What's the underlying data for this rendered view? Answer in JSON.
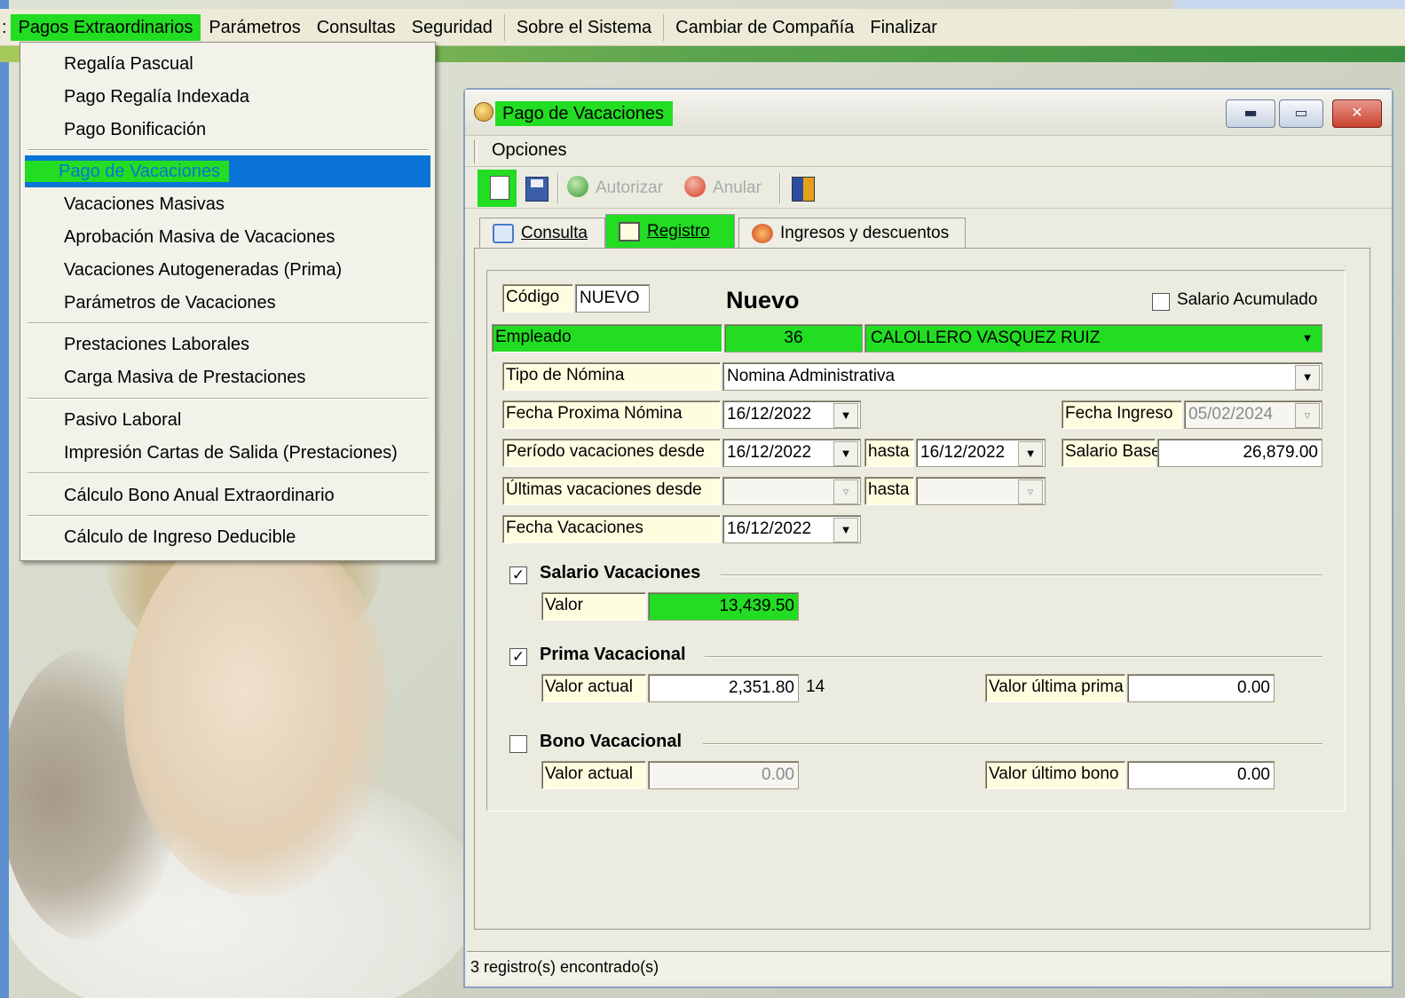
{
  "menubar": {
    "lead": ":",
    "items": [
      "Pagos Extraordinarios",
      "Parámetros",
      "Consultas",
      "Seguridad",
      "Sobre el Sistema",
      "Cambiar de Compañía",
      "Finalizar"
    ]
  },
  "dropdown": {
    "items": [
      "Regalía Pascual",
      "Pago Regalía Indexada",
      "Pago Bonificación",
      "Pago de Vacaciones",
      "Vacaciones Masivas",
      "Aprobación Masiva de Vacaciones",
      "Vacaciones Autogeneradas (Prima)",
      "Parámetros de Vacaciones",
      "Prestaciones Laborales",
      "Carga Masiva de Prestaciones",
      "Pasivo Laboral",
      "Impresión Cartas de Salida (Prestaciones)",
      "Cálculo Bono Anual Extraordinario",
      "Cálculo de Ingreso Deducible"
    ]
  },
  "window": {
    "title": "Pago de Vacaciones",
    "options_label": "Opciones",
    "toolbar": {
      "authorize": "Autorizar",
      "cancel": "Anular"
    },
    "tabs": {
      "consulta": "Consulta",
      "registro": "Registro",
      "ingresos": "Ingresos y descuentos"
    },
    "status": "3 registro(s) encontrado(s)"
  },
  "form": {
    "codigo_label": "Código",
    "codigo_value": "NUEVO",
    "mode": "Nuevo",
    "salario_acumulado_label": "Salario Acumulado",
    "empleado_label": "Empleado",
    "empleado_id": "36",
    "empleado_name": "CALOLLERO VASQUEZ RUIZ",
    "tipo_nomina_label": "Tipo de Nómina",
    "tipo_nomina_value": "Nomina Administrativa",
    "fecha_proxima_label": "Fecha Proxima Nómina",
    "fecha_proxima_value": "16/12/2022",
    "fecha_ingreso_label": "Fecha Ingreso",
    "fecha_ingreso_value": "05/02/2024",
    "periodo_label": "Período vacaciones desde",
    "periodo_desde": "16/12/2022",
    "hasta_label": "hasta",
    "periodo_hasta": "16/12/2022",
    "salario_base_label": "Salario Base",
    "salario_base_value": "26,879.00",
    "ultimas_label": "Últimas vacaciones desde",
    "ultimas_desde": "",
    "ultimas_hasta": "",
    "fecha_vac_label": "Fecha Vacaciones",
    "fecha_vac_value": "16/12/2022",
    "salario_vac_title": "Salario Vacaciones",
    "valor_label": "Valor",
    "salario_vac_value": "13,439.50",
    "prima_title": "Prima Vacacional",
    "valor_actual_label": "Valor actual",
    "prima_value": "2,351.80",
    "prima_days": "14",
    "valor_ultima_prima_label": "Valor última prima",
    "valor_ultima_prima": "0.00",
    "bono_title": "Bono Vacacional",
    "bono_value": "0.00",
    "valor_ultimo_bono_label": "Valor último bono",
    "valor_ultimo_bono": "0.00"
  }
}
